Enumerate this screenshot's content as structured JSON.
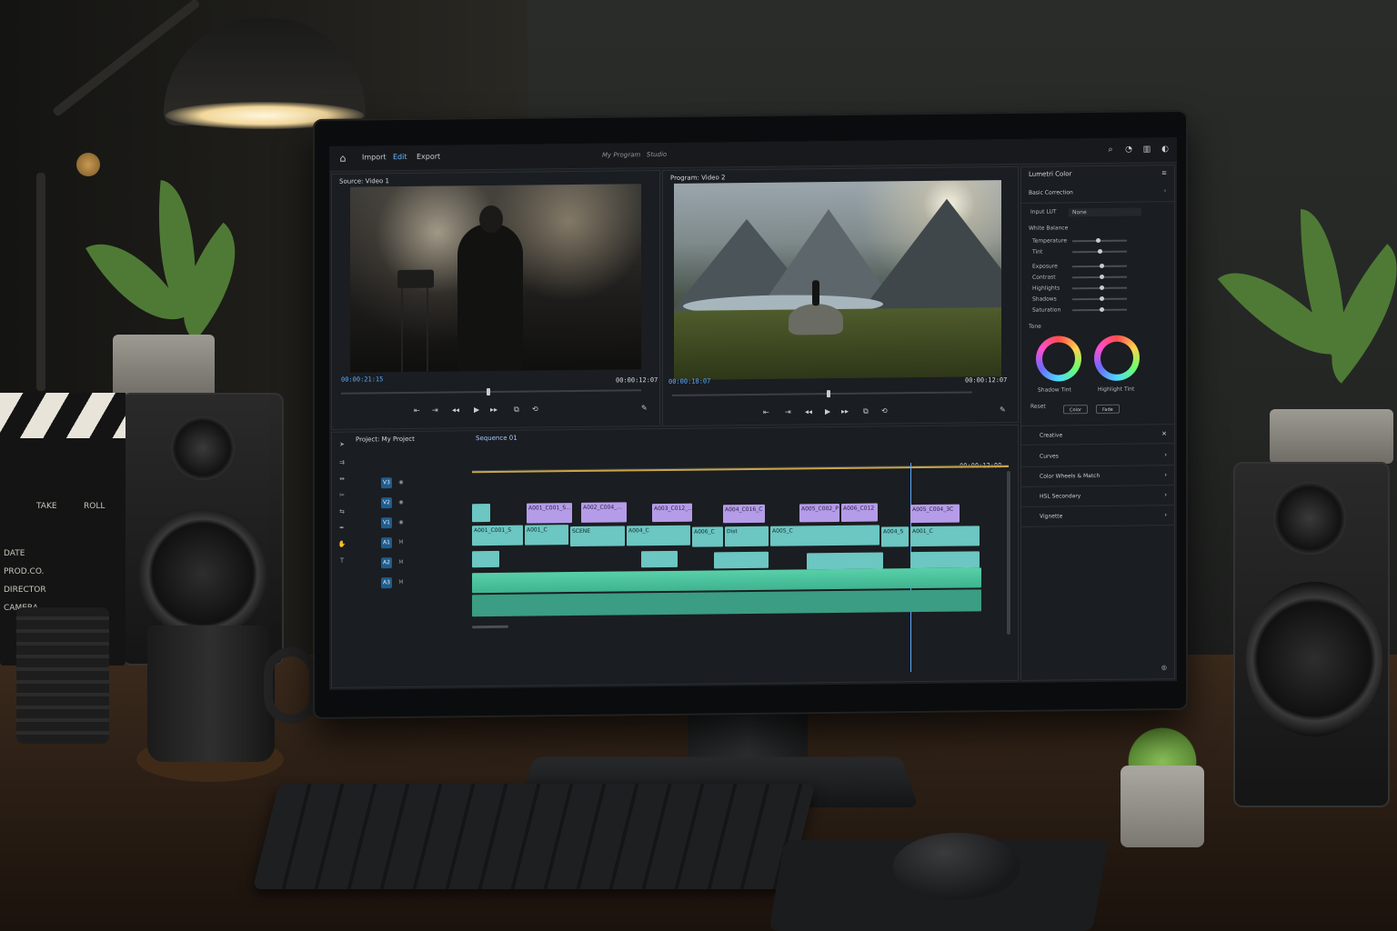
{
  "app": {
    "menu": [
      "Import",
      "Edit",
      "Export"
    ],
    "active_menu": "Edit",
    "doc_title": "My Program",
    "doc_sub": "Studio"
  },
  "source_monitor": {
    "title": "Source: Video 1",
    "tc_current": "00:00:21:15",
    "tc_total": "00:00:12:07"
  },
  "program_monitor": {
    "title": "Program: Video 2",
    "tc_current": "00:00:18:07",
    "tc_total": "00:00:12:07"
  },
  "project": {
    "title": "Project: My Project"
  },
  "timeline": {
    "sequence_tab": "Sequence 01",
    "timecode_end": "00:00:12:00",
    "video_clips": [
      "A001_C001_S...",
      "A002_C004_...",
      "A003_C012_...",
      "A004_C016_C",
      "A005_C002_P",
      "A006_C012",
      "A005_C004_3C"
    ],
    "v1_clips": [
      "A001_C001_S",
      "A001_C",
      "SCENE",
      "A004_C",
      "A006_C",
      "Dist",
      "A005_C",
      "A004_S",
      "A001_C"
    ]
  },
  "lumetri": {
    "title": "Lumetri Color",
    "basic_correction": "Basic Correction",
    "input_lut_label": "Input LUT",
    "input_lut_value": "None",
    "white_balance": "White Balance",
    "temperature": "Temperature",
    "tint": "Tint",
    "exposure": "Exposure",
    "contrast": "Contrast",
    "highlights": "Highlights",
    "shadows": "Shadows",
    "saturation": "Saturation",
    "tone": "Tone",
    "shadow_tint": "Shadow Tint",
    "highlight_tint": "Highlight Tint",
    "reset_label": "Reset",
    "btn_a": "Color",
    "btn_b": "Fade",
    "creative": "Creative",
    "sections": [
      "Curves",
      "Color Wheels & Match",
      "HSL Secondary",
      "Vignette"
    ]
  },
  "clapper": {
    "roll": "ROLL",
    "take": "TAKE",
    "date": "DATE",
    "prod": "PROD.CO.",
    "director": "DIRECTOR",
    "camera": "CAMERA"
  },
  "colors": {
    "accent": "#5aa8ff",
    "clip_purple": "#b59ce8",
    "clip_teal": "#6cc6c2",
    "clip_audio": "#58d0a8"
  }
}
